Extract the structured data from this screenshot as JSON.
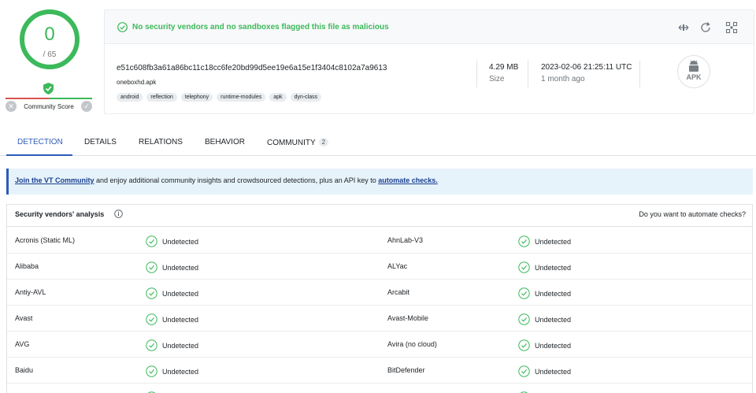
{
  "score": {
    "detections": "0",
    "total": "/ 65",
    "community_label": "Community Score",
    "colors": {
      "clean": "#3cb95b",
      "malicious": "#d9534f"
    }
  },
  "banner": {
    "message": "No security vendors and no sandboxes flagged this file as malicious"
  },
  "file": {
    "hash": "e51c608fb3a61a86bc11c18cc6fe20bd99d5ee19e6a15e1f3404c8102a7a9613",
    "name": "oneboxhd.apk",
    "tags": [
      "android",
      "reflection",
      "telephony",
      "runtime-modules",
      "apk",
      "dyn-class"
    ],
    "size_value": "4.29 MB",
    "size_label": "Size",
    "date_value": "2023-02-06 21:25:11 UTC",
    "date_ago": "1 month ago",
    "type_badge": "APK"
  },
  "tabs": [
    {
      "label": "DETECTION",
      "active": true
    },
    {
      "label": "DETAILS"
    },
    {
      "label": "RELATIONS"
    },
    {
      "label": "BEHAVIOR"
    },
    {
      "label": "COMMUNITY",
      "badge": "2"
    }
  ],
  "join": {
    "link1": "Join the VT Community",
    "text_mid": " and enjoy additional community insights and crowdsourced detections, plus an API key to ",
    "link2": "automate checks."
  },
  "vendors": {
    "title": "Security vendors' analysis",
    "automate_prompt": "Do you want to automate checks?",
    "rows": [
      {
        "left_name": "Acronis (Static ML)",
        "left_result": "Undetected",
        "right_name": "AhnLab-V3",
        "right_result": "Undetected"
      },
      {
        "left_name": "Alibaba",
        "left_result": "Undetected",
        "right_name": "ALYac",
        "right_result": "Undetected"
      },
      {
        "left_name": "Antiy-AVL",
        "left_result": "Undetected",
        "right_name": "Arcabit",
        "right_result": "Undetected"
      },
      {
        "left_name": "Avast",
        "left_result": "Undetected",
        "right_name": "Avast-Mobile",
        "right_result": "Undetected"
      },
      {
        "left_name": "AVG",
        "left_result": "Undetected",
        "right_name": "Avira (no cloud)",
        "right_result": "Undetected"
      },
      {
        "left_name": "Baidu",
        "left_result": "Undetected",
        "right_name": "BitDefender",
        "right_result": "Undetected"
      }
    ]
  }
}
